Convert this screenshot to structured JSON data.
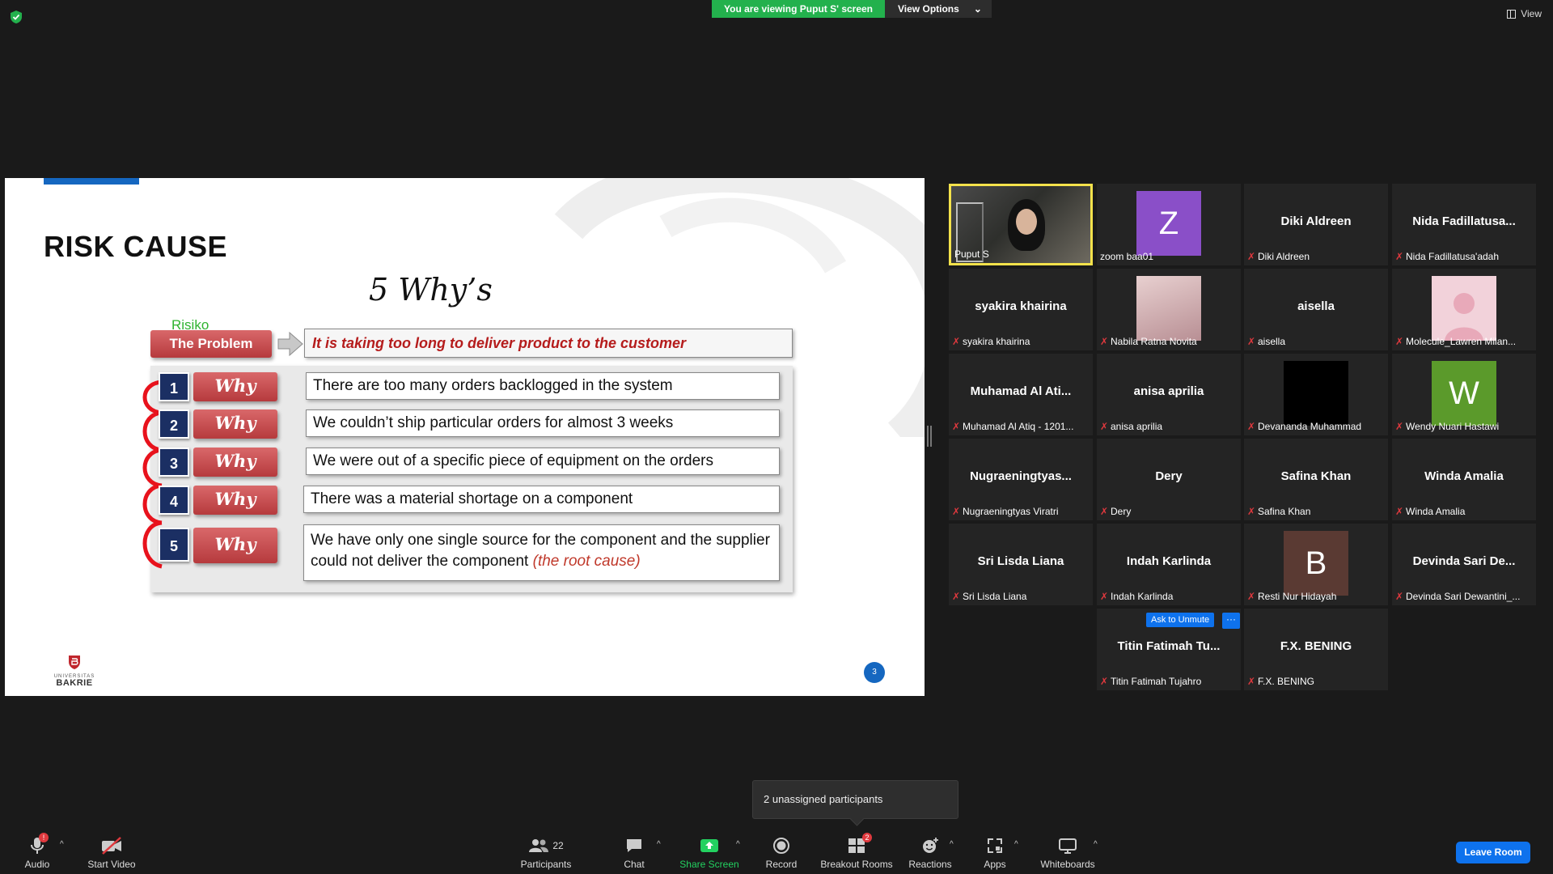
{
  "top": {
    "viewing_text": "You are viewing Puput S' screen",
    "view_options": "View Options",
    "view_label": "View"
  },
  "slide": {
    "title": "RISK CAUSE",
    "subtitle": "5 Why’s",
    "risiko": "Risiko",
    "problem_label": "The Problem",
    "problem_text": "It is taking too long to deliver product to the customer",
    "whys": [
      {
        "num": "1",
        "tag": "Why",
        "text": "There are too  many orders backlogged in the system"
      },
      {
        "num": "2",
        "tag": "Why",
        "text": "We couldn’t ship particular orders for almost 3 weeks"
      },
      {
        "num": "3",
        "tag": "Why",
        "text": "We were out of a specific piece of equipment on the orders"
      },
      {
        "num": "4",
        "tag": "Why",
        "text": "There was a material shortage on a component"
      },
      {
        "num": "5",
        "tag": "Why",
        "text": "We have only one single source for the component and the supplier could not deliver the component",
        "root": "(the root cause)"
      }
    ],
    "logo_small": "UNIVERSITAS",
    "logo_name": "BAKRIE",
    "page_number": "3"
  },
  "participants": [
    {
      "name": "",
      "footer": "Puput S",
      "muted": false
    },
    {
      "name": "",
      "footer": "zoom baa01",
      "muted": false,
      "avatar": "Z",
      "avatar_color": "#8a4fc8"
    },
    {
      "name": "Diki Aldreen",
      "footer": "Diki Aldreen",
      "muted": true
    },
    {
      "name": "Nida  Fadillatusa...",
      "footer": "Nida Fadillatusa'adah",
      "muted": true
    },
    {
      "name": "syakira khairina",
      "footer": "syakira khairina",
      "muted": true
    },
    {
      "name": "",
      "footer": "Nabila Ratna Novita",
      "muted": true,
      "avatar": "",
      "avatar_color": "#d9b8b8"
    },
    {
      "name": "aisella",
      "footer": "aisella",
      "muted": true
    },
    {
      "name": "",
      "footer": "Molecule_Lawren Milan...",
      "muted": true,
      "avatar": "",
      "avatar_color": "#f2d2da"
    },
    {
      "name": "Muhamad Al Ati...",
      "footer": "Muhamad Al Atiq - 1201...",
      "muted": true
    },
    {
      "name": "anisa aprilia",
      "footer": "anisa aprilia",
      "muted": true
    },
    {
      "name": "",
      "footer": "Devananda Muhammad",
      "muted": true,
      "avatar": "",
      "avatar_color": "#000000"
    },
    {
      "name": "",
      "footer": "Wendy Nuari Hastawi",
      "muted": true,
      "avatar": "W",
      "avatar_color": "#5b9a2b"
    },
    {
      "name": "Nugraeningtyas...",
      "footer": "Nugraeningtyas Viratri",
      "muted": true
    },
    {
      "name": "Dery",
      "footer": "Dery",
      "muted": true
    },
    {
      "name": "Safina Khan",
      "footer": "Safina Khan",
      "muted": true
    },
    {
      "name": "Winda Amalia",
      "footer": "Winda Amalia",
      "muted": true
    },
    {
      "name": "Sri Lisda Liana",
      "footer": "Sri Lisda Liana",
      "muted": true
    },
    {
      "name": "Indah Karlinda",
      "footer": "Indah Karlinda",
      "muted": true
    },
    {
      "name": "",
      "footer": "Resti Nur Hidayah",
      "muted": true,
      "avatar": "B",
      "avatar_color": "#5a3a33"
    },
    {
      "name": "Devinda  Sari  De...",
      "footer": "Devinda Sari Dewantini_...",
      "muted": true
    },
    {
      "name": "Titin Fatimah Tu...",
      "footer": "Titin Fatimah Tujahro",
      "muted": true
    },
    {
      "name": "F.X. BENING",
      "footer": "F.X. BENING",
      "muted": true
    }
  ],
  "ask_unmute": "Ask to Unmute",
  "more": "···",
  "tooltip": "2 unassigned participants",
  "toolbar": {
    "audio": "Audio",
    "audio_badge": "!",
    "video": "Start Video",
    "participants": "Participants",
    "participants_count": "22",
    "chat": "Chat",
    "share": "Share Screen",
    "record": "Record",
    "breakout": "Breakout Rooms",
    "breakout_badge": "2",
    "reactions": "Reactions",
    "apps": "Apps",
    "whiteboards": "Whiteboards",
    "leave": "Leave Room"
  }
}
